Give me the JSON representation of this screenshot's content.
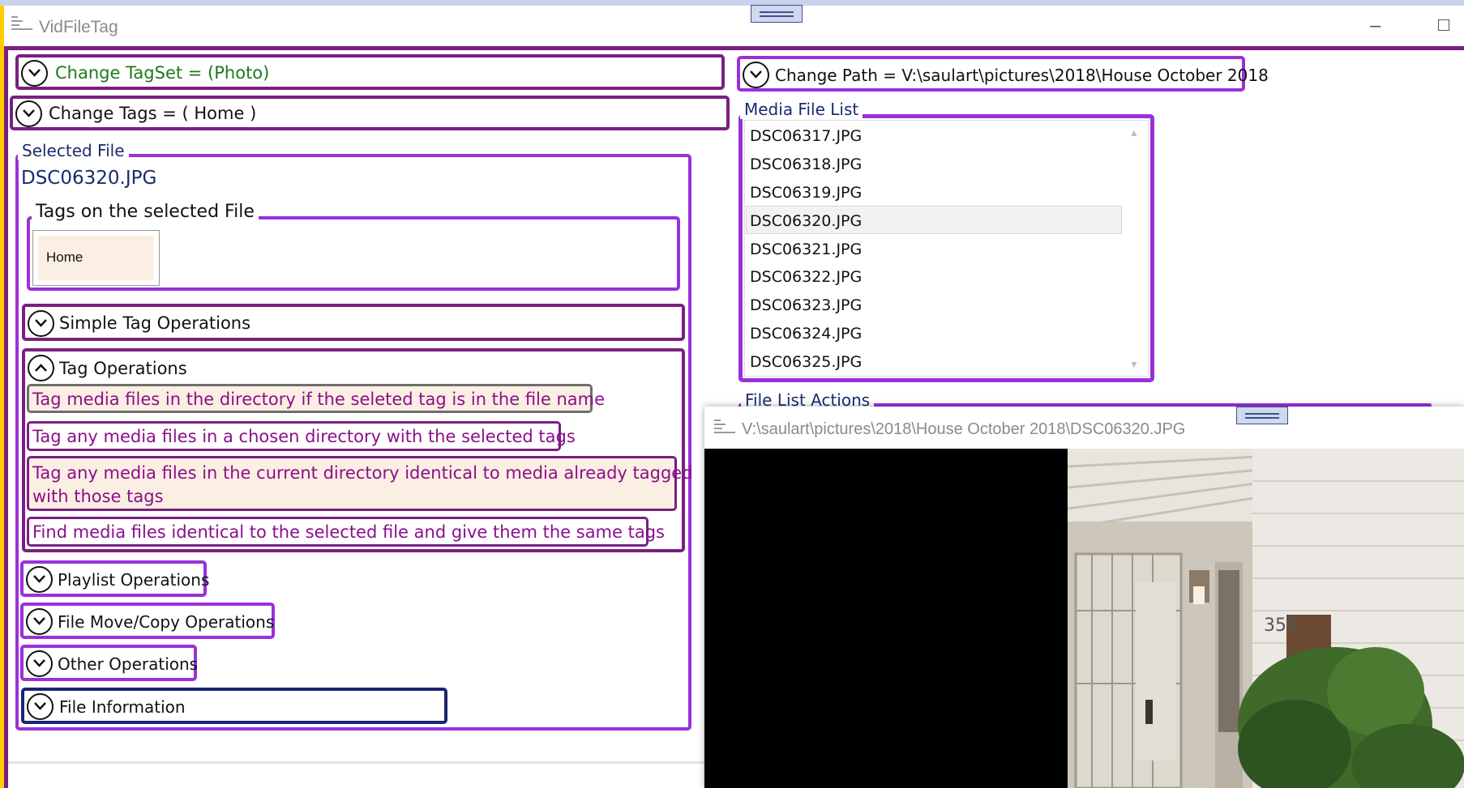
{
  "window": {
    "title": "VidFileTag"
  },
  "left": {
    "change_tagset": "Change TagSet = (Photo)",
    "change_tags": "Change Tags = ( Home )",
    "selected_file_label": "Selected File",
    "selected_file_name": "DSC06320.JPG",
    "tags_on_file_label": "Tags on the selected File",
    "tags": [
      "Home"
    ],
    "simple_tag_ops": "Simple Tag Operations",
    "tag_ops": "Tag Operations",
    "tag_op_items": [
      "Tag media files in the directory if the seleted tag is in the file name",
      "Tag any media files in a chosen directory with the selected tags",
      "Tag any media files in the current directory identical to media already tagged",
      "with those tags",
      "Find media files identical to the selected file and give them the same tags"
    ],
    "playlist_ops": "Playlist Operations",
    "file_move_ops": "File Move/Copy Operations",
    "other_ops": "Other Operations",
    "file_info": "File Information"
  },
  "right": {
    "change_path": "Change Path = V:\\saulart\\pictures\\2018\\House October 2018",
    "media_list_label": "Media File List",
    "files": [
      "DSC06317.JPG",
      "DSC06318.JPG",
      "DSC06319.JPG",
      "DSC06320.JPG",
      "DSC06321.JPG",
      "DSC06322.JPG",
      "DSC06323.JPG",
      "DSC06324.JPG",
      "DSC06325.JPG"
    ],
    "selected_file": "DSC06320.JPG",
    "file_list_actions_label": "File List Actions"
  },
  "viewer": {
    "title": "V:\\saulart\\pictures\\2018\\House October 2018\\DSC06320.JPG"
  },
  "icons": {
    "expand": "chevron-down-icon",
    "collapse": "chevron-up-icon",
    "app": "app-icon",
    "grip": "drag-handle-icon",
    "minimize": "minimize-icon",
    "maximize": "maximize-icon"
  },
  "colors": {
    "frame": "#7a1f80",
    "violet": "#9b30d9",
    "navy": "#1c2570",
    "tagset_text": "#1b7a1b",
    "operation_text": "#8b0f8b",
    "op_highlight": "#fbeee2",
    "group_label": "#1a2b6e"
  }
}
